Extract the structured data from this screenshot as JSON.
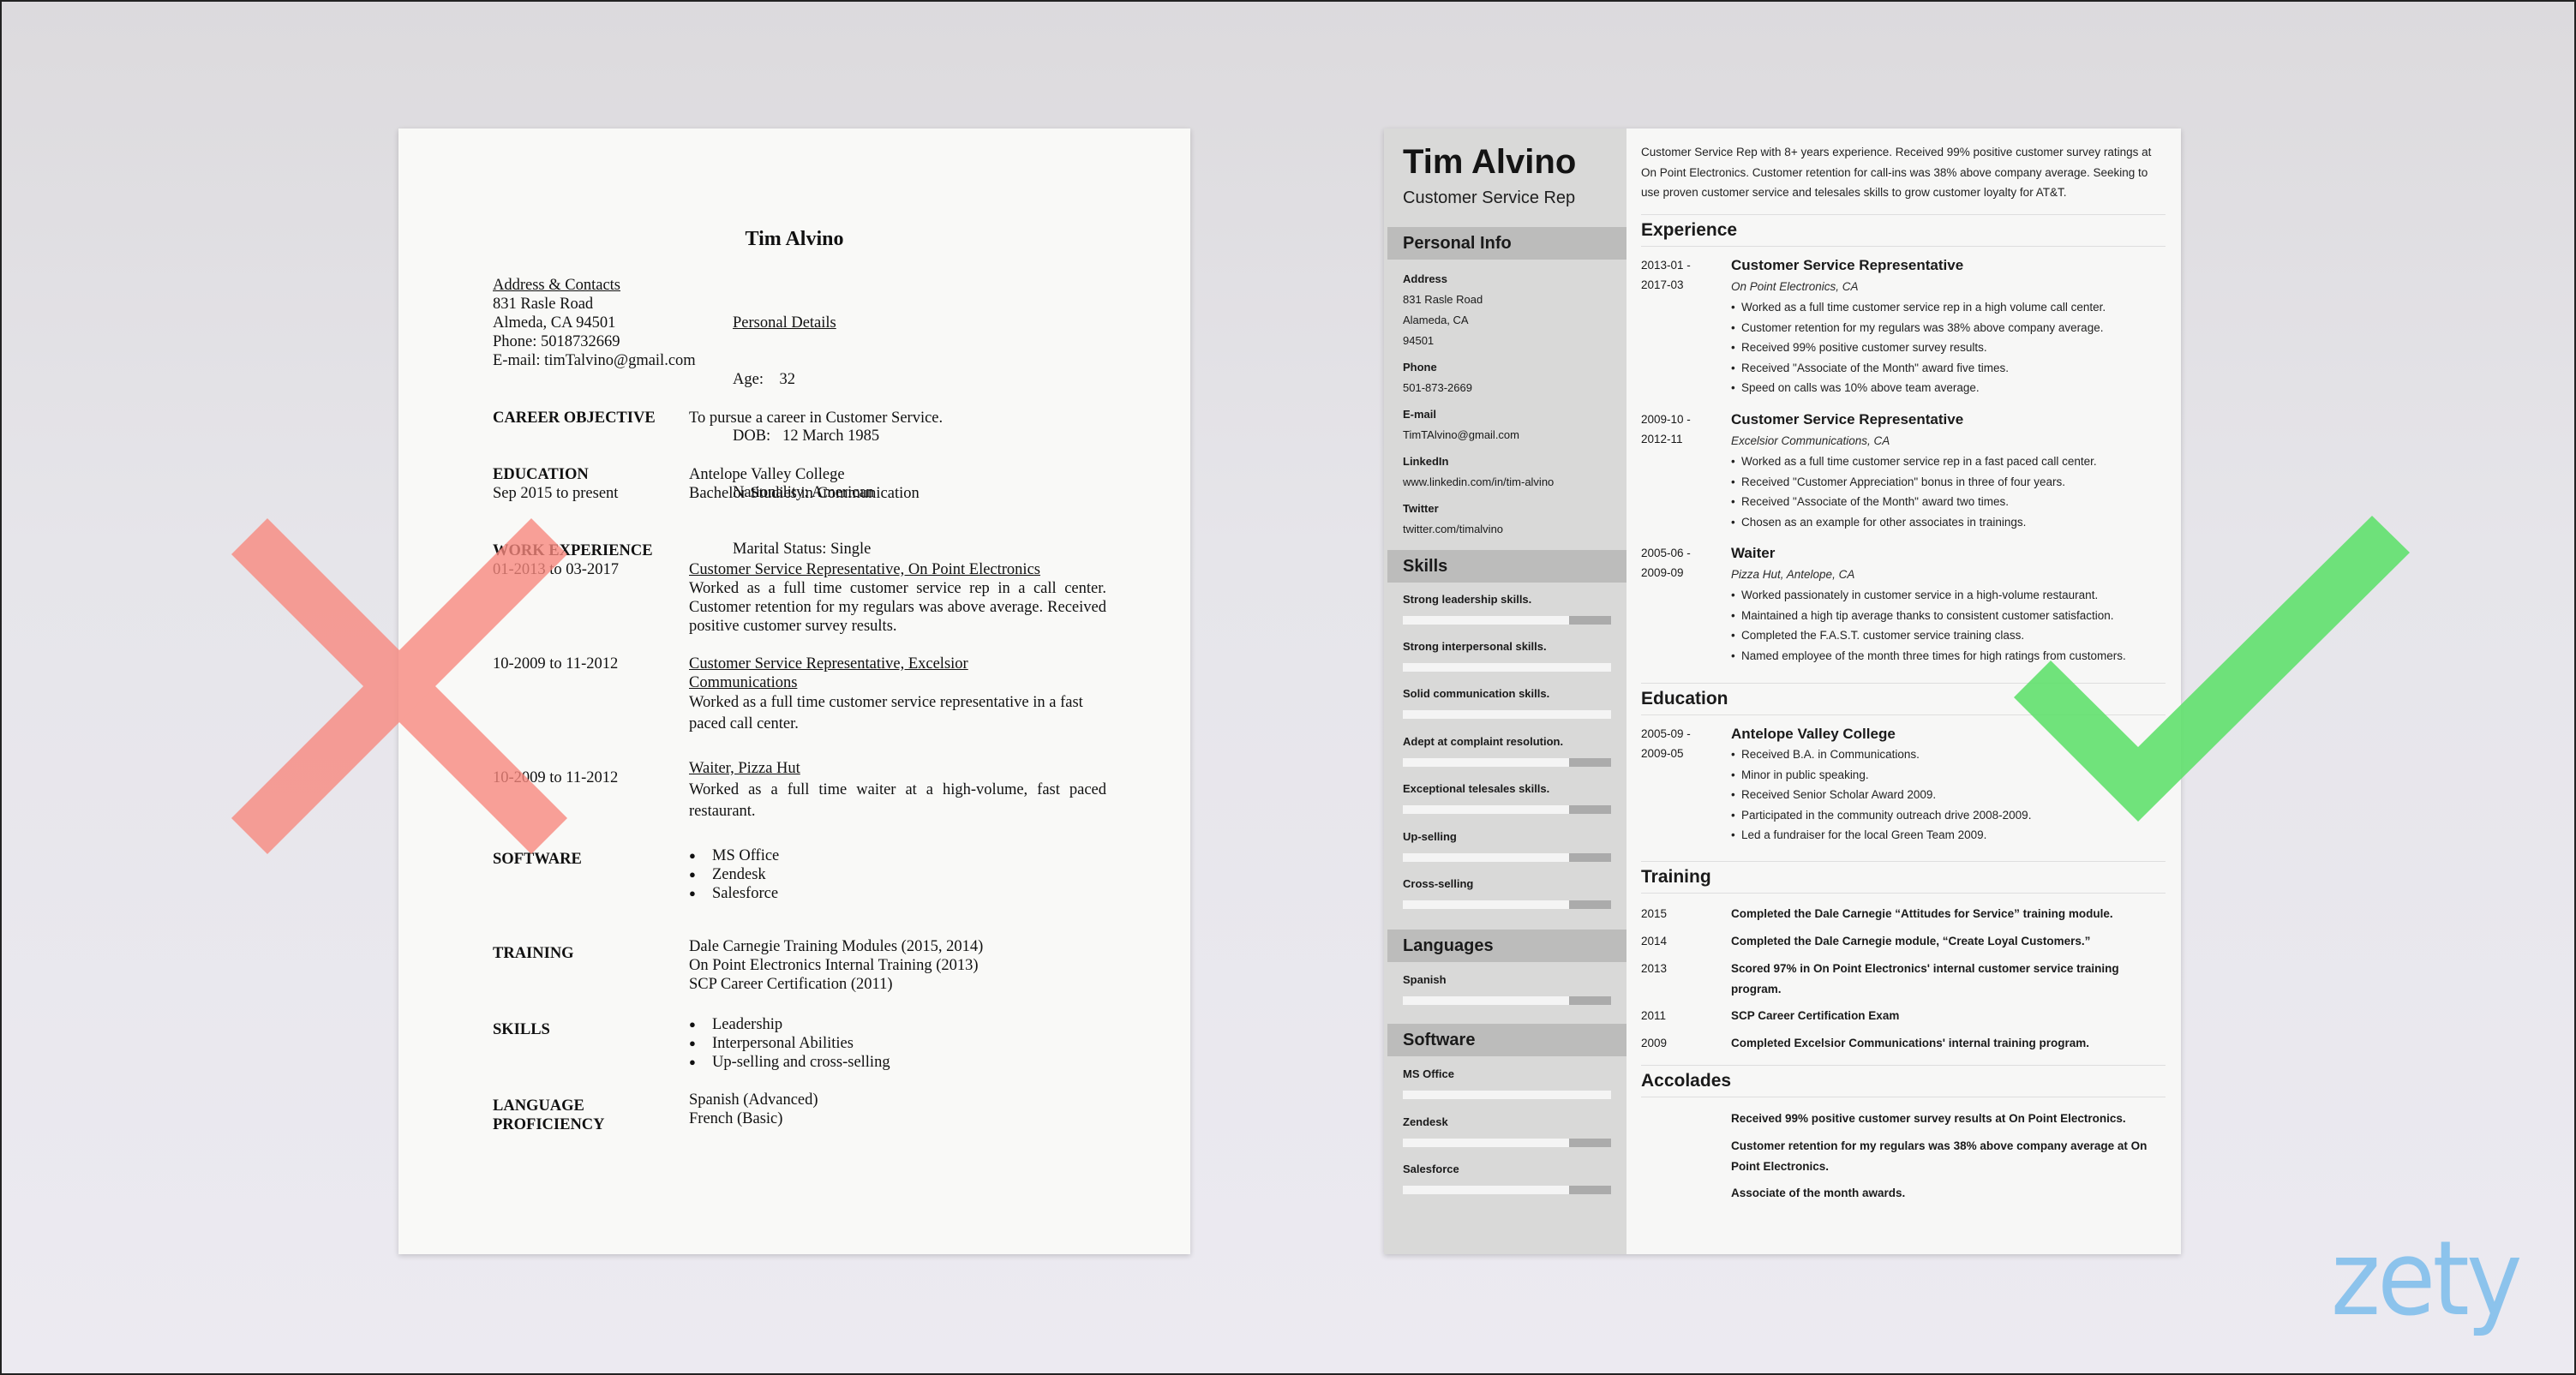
{
  "colors": {
    "bad_mark": "#f8877d",
    "good_mark": "#5de06a",
    "logo": "#8cc3ec",
    "sidebar_bg": "#d9d9d8",
    "sidebar_header_bg": "#bcbcbb"
  },
  "icons": {
    "bad": "x-mark-icon",
    "good": "checkmark-icon"
  },
  "logo": "zety",
  "bad_resume": {
    "name": "Tim Alvino",
    "contacts": {
      "heading": "Address & Contacts",
      "lines": [
        "831 Rasle Road",
        "Almeda, CA 94501",
        "Phone: 5018732669",
        "E-mail: timTalvino@gmail.com"
      ]
    },
    "personal": {
      "heading": "Personal Details",
      "lines": [
        "Age:    32",
        "DOB:   12 March 1985",
        "Nationality: American",
        "Marital Status: Single"
      ]
    },
    "career_objective": {
      "label": "CAREER OBJECTIVE",
      "text": "To pursue a career in Customer Service."
    },
    "education": {
      "label": "EDUCATION",
      "dates": "Sep 2015 to present",
      "school": "Antelope Valley College",
      "degree": "Bachelor Studies in Communication"
    },
    "work": {
      "label": "WORK EXPERIENCE",
      "jobs": [
        {
          "dates": "01-2013 to 03-2017",
          "title": "Customer Service Representative, On Point Electronics",
          "desc": "Worked as a full time customer service rep in a call center. Customer retention for my regulars was above average. Received positive customer survey results."
        },
        {
          "dates": "10-2009 to 11-2012",
          "title": "Customer Service Representative, Excelsior Communications",
          "desc": "Worked as a full time customer service representative in a fast paced call center."
        },
        {
          "dates": "10-2009 to 11-2012",
          "title": "Waiter, Pizza Hut",
          "desc": "Worked as a full time waiter at a high-volume, fast paced restaurant."
        }
      ]
    },
    "software": {
      "label": "SOFTWARE",
      "items": [
        "MS Office",
        "Zendesk",
        "Salesforce"
      ]
    },
    "training": {
      "label": "TRAINING",
      "items": [
        "Dale Carnegie Training Modules (2015, 2014)",
        "On Point Electronics Internal Training (2013)",
        "SCP Career Certification (2011)"
      ]
    },
    "skills": {
      "label": "SKILLS",
      "items": [
        "Leadership",
        "Interpersonal Abilities",
        "Up-selling and cross-selling"
      ]
    },
    "languages": {
      "label_line1": "LANGUAGE",
      "label_line2": "PROFICIENCY",
      "items": [
        "Spanish (Advanced)",
        "French (Basic)"
      ]
    }
  },
  "good_resume": {
    "name": "Tim Alvino",
    "role": "Customer Service Rep",
    "sidebar": {
      "personal_info": {
        "heading": "Personal Info",
        "fields": [
          {
            "label": "Address",
            "values": [
              "831 Rasle Road",
              "Alameda, CA",
              "94501"
            ]
          },
          {
            "label": "Phone",
            "values": [
              "501-873-2669"
            ]
          },
          {
            "label": "E-mail",
            "values": [
              "TimTAlvino@gmail.com"
            ]
          },
          {
            "label": "LinkedIn",
            "values": [
              "www.linkedin.com/in/tim-alvino"
            ]
          },
          {
            "label": "Twitter",
            "values": [
              "twitter.com/timalvino"
            ]
          }
        ]
      },
      "skills": {
        "heading": "Skills",
        "items": [
          {
            "label": "Strong leadership skills.",
            "level": 0.8
          },
          {
            "label": "Strong interpersonal skills.",
            "level": 1.0
          },
          {
            "label": "Solid communication skills.",
            "level": 1.0
          },
          {
            "label": "Adept at complaint resolution.",
            "level": 0.8
          },
          {
            "label": "Exceptional telesales skills.",
            "level": 0.8
          },
          {
            "label": "Up-selling",
            "level": 0.8
          },
          {
            "label": "Cross-selling",
            "level": 0.8
          }
        ]
      },
      "languages": {
        "heading": "Languages",
        "items": [
          {
            "label": "Spanish",
            "level": 0.8
          }
        ]
      },
      "software": {
        "heading": "Software",
        "items": [
          {
            "label": "MS Office",
            "level": 1.0
          },
          {
            "label": "Zendesk",
            "level": 0.8
          },
          {
            "label": "Salesforce",
            "level": 0.8
          }
        ]
      }
    },
    "summary": "Customer Service Rep with 8+ years experience. Received 99% positive customer survey ratings at On Point Electronics. Customer retention for call-ins was 38% above company average. Seeking to use proven customer service and telesales skills to grow customer loyalty for AT&T.",
    "experience": {
      "heading": "Experience",
      "jobs": [
        {
          "date_start": "2013-01 -",
          "date_end": "2017-03",
          "title": "Customer Service Representative",
          "company": "On Point Electronics, CA",
          "bullets": [
            "Worked as a full time customer service rep in a high volume call center.",
            "Customer retention for my regulars was 38% above company average.",
            "Received 99% positive customer survey results.",
            "Received \"Associate of the Month\" award five times.",
            "Speed on calls was 10% above team average."
          ]
        },
        {
          "date_start": "2009-10 -",
          "date_end": "2012-11",
          "title": "Customer Service Representative",
          "company": "Excelsior Communications, CA",
          "bullets": [
            "Worked as a full time customer service rep in a fast paced call center.",
            "Received \"Customer Appreciation\" bonus in three of four years.",
            "Received \"Associate of the Month\" award two times.",
            "Chosen as an example for other associates in trainings."
          ]
        },
        {
          "date_start": "2005-06 -",
          "date_end": "2009-09",
          "title": "Waiter",
          "company": "Pizza Hut, Antelope, CA",
          "bullets": [
            "Worked passionately in customer service in a high-volume restaurant.",
            "Maintained a high tip average thanks to consistent customer satisfaction.",
            "Completed the F.A.S.T. customer service training class.",
            "Named employee of the month three times for high ratings from customers."
          ]
        }
      ]
    },
    "education": {
      "heading": "Education",
      "date_start": "2005-09 -",
      "date_end": "2009-05",
      "school": "Antelope Valley College",
      "bullets": [
        "Received B.A. in Communications.",
        "Minor in public speaking.",
        "Received Senior Scholar Award 2009.",
        "Participated in the community outreach drive 2008-2009.",
        "Led a fundraiser for the local Green Team 2009."
      ]
    },
    "training": {
      "heading": "Training",
      "items": [
        {
          "year": "2015",
          "text": "Completed the Dale Carnegie “Attitudes for Service” training module."
        },
        {
          "year": "2014",
          "text": "Completed the Dale Carnegie module, “Create Loyal Customers.”"
        },
        {
          "year": "2013",
          "text": "Scored 97% in On Point Electronics' internal customer service training program."
        },
        {
          "year": "2011",
          "text": "SCP Career Certification Exam"
        },
        {
          "year": "2009",
          "text": "Completed Excelsior Communications' internal training program."
        }
      ]
    },
    "accolades": {
      "heading": "Accolades",
      "items": [
        "Received 99% positive customer survey results at On Point Electronics.",
        "Customer retention for my regulars was 38% above company average at On Point Electronics.",
        "Associate of the month awards."
      ]
    }
  }
}
